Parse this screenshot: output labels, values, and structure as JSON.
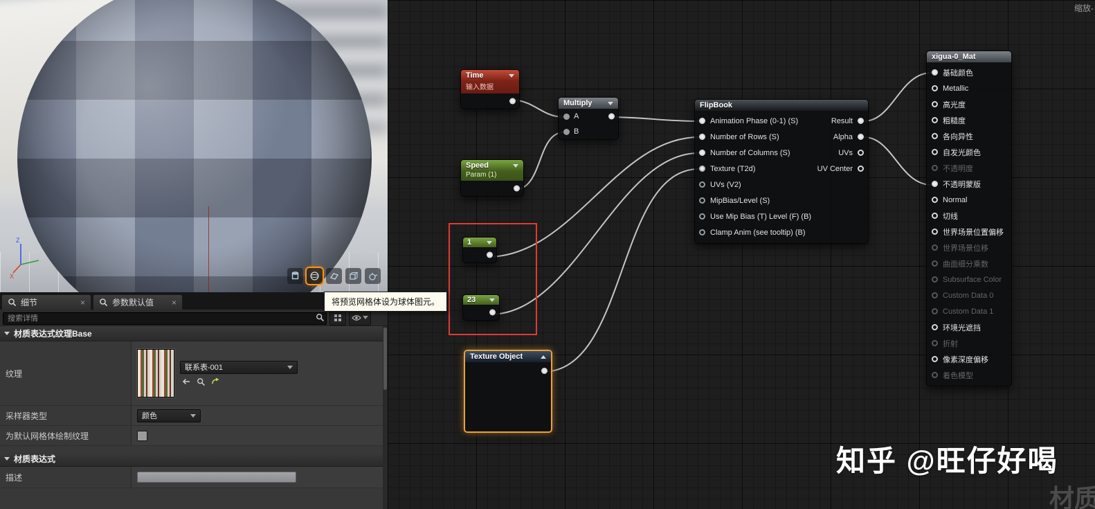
{
  "window": {
    "zoom_label": "缩放-",
    "watermark": "知乎 @旺仔好喝",
    "watermark_faint": "材质"
  },
  "viewport": {
    "tooltip": "将预览网格体设为球体图元。",
    "axis": {
      "z": "Z",
      "x": "X"
    },
    "toolbar_icons": [
      "cylinder",
      "sphere",
      "plane",
      "cube",
      "teapot"
    ]
  },
  "tabs": {
    "details": "细节",
    "param_defaults": "参数默认值",
    "close": "×"
  },
  "details": {
    "search_placeholder": "搜索详情",
    "section_texture_base": "材质表达式纹理Base",
    "texture_label": "纹理",
    "texture_asset": "联系表-001",
    "sampler_label": "采样器类型",
    "sampler_value": "颜色",
    "draw_default_label": "为默认网格体绘制纹理",
    "section_expression": "材质表达式",
    "desc_label": "描述"
  },
  "graph": {
    "time": {
      "title": "Time",
      "subtitle": "输入数据"
    },
    "multiply": {
      "title": "Multiply",
      "in_a": "A",
      "in_b": "B"
    },
    "speed": {
      "title": "Speed",
      "subtitle": "Param (1)"
    },
    "const_rows": {
      "title": "1"
    },
    "const_cols": {
      "title": "23"
    },
    "texture_object": {
      "title": "Texture Object"
    },
    "flipbook": {
      "title": "FlipBook",
      "inputs": [
        "Animation Phase (0-1) (S)",
        "Number of Rows (S)",
        "Number of Columns (S)",
        "Texture (T2d)",
        "UVs (V2)",
        "MipBias/Level (S)",
        "Use Mip Bias (T) Level (F) (B)",
        "Clamp Anim (see tooltip) (B)"
      ],
      "outputs": [
        "Result",
        "Alpha",
        "UVs",
        "UV Center"
      ]
    },
    "material": {
      "title": "xigua-0_Mat",
      "pins": [
        "基础颜色",
        "Metallic",
        "高光度",
        "粗糙度",
        "各向异性",
        "自发光颜色",
        "不透明度",
        "不透明蒙版",
        "Normal",
        "切线",
        "世界场景位置偏移",
        "世界场景位移",
        "曲面细分乘数",
        "Subsurface Color",
        "Custom Data 0",
        "Custom Data 1",
        "环境光遮挡",
        "折射",
        "像素深度偏移",
        "着色模型"
      ]
    }
  },
  "colors": {
    "selection_orange": "#eba13a",
    "marker_red": "#e23a33",
    "node_red": "#a93226",
    "node_green": "#5a8f2f",
    "wire": "#d8d8d8"
  }
}
